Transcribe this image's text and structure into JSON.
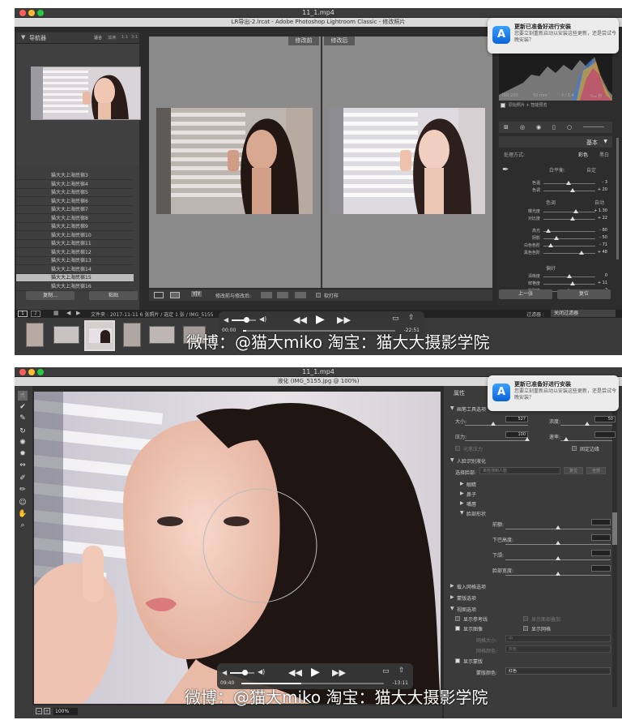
{
  "shot1": {
    "mac_title": "11_1.mp4",
    "window_title": "LR导出-2.lrcat - Adobe Photoshop Lightroom Classic - 修改照片",
    "notification": {
      "title": "更新已准备好进行安装",
      "body": "您要立刻重新启动以安装这些更新，还是尝试今晚安装？"
    },
    "navigator": {
      "title": "导航器",
      "options": [
        "适合",
        "填满",
        "1:1",
        "3:1"
      ]
    },
    "files": [
      "猫大大上海民宿3",
      "猫大大上海民宿4",
      "猫大大上海民宿5",
      "猫大大上海民宿6",
      "猫大大上海民宿7",
      "猫大大上海民宿8",
      "猫大大上海民宿9",
      "猫大大上海民宿10",
      "猫大大上海民宿11",
      "猫大大上海民宿12",
      "猫大大上海民宿13",
      "猫大大上海民宿14",
      "猫大大上海民宿15",
      "猫大大上海民宿16"
    ],
    "selected_file_index": 12,
    "copy_button": "复制...",
    "paste_button": "粘贴",
    "before_label": "修改前",
    "after_label": "修改后",
    "toolbar": {
      "compare_label": "修改前与修改后:",
      "proof_label": "软打样",
      "yy_label": "Y|Y"
    },
    "histogram_info": {
      "iso": "ISO 200",
      "focal": "50 mm",
      "aperture": "f / 1.4",
      "shutter": "¹⁄₂₅₀ 秒",
      "original": "原始照片 + 智能预览"
    },
    "basic": {
      "title": "基本",
      "treatment_label": "处理方式:",
      "color": "彩色",
      "bw": "黑白",
      "wb_label": "白平衡:",
      "wb_value": "自定",
      "tone_label": "色调",
      "tone_auto": "自动",
      "presence_label": "偏好",
      "sliders": [
        {
          "label": "色温",
          "value": "- 3",
          "pos": 0.48
        },
        {
          "label": "色调",
          "value": "+ 20",
          "pos": 0.56
        },
        {
          "label": "曝光度",
          "value": "+ 1.30",
          "pos": 0.62
        },
        {
          "label": "对比度",
          "value": "+ 22",
          "pos": 0.56
        },
        {
          "label": "高光",
          "value": "- 80",
          "pos": 0.1
        },
        {
          "label": "阴影",
          "value": "- 50",
          "pos": 0.25
        },
        {
          "label": "白色色阶",
          "value": "- 71",
          "pos": 0.14
        },
        {
          "label": "黑色色阶",
          "value": "+ 48",
          "pos": 0.74
        },
        {
          "label": "清晰度",
          "value": "0",
          "pos": 0.5
        },
        {
          "label": "鲜艳度",
          "value": "+ 11",
          "pos": 0.56
        },
        {
          "label": "饱和度",
          "value": "- 2",
          "pos": 0.49
        }
      ]
    },
    "prev_button": "上一张",
    "reset_button": "复位",
    "filmstrip_info": "文件夹 : 2017-11-11   6 张照片 / 选定 1 张 / IMG_5155",
    "filter_label": "过滤器 :",
    "filter_value": "关闭过滤器",
    "page_tabs": [
      "1",
      "2"
    ],
    "player": {
      "elapsed": "00:00",
      "remaining": "-22:51",
      "progress": 0.02,
      "volume": 0.6
    },
    "subtitle": "微博：@猫大miko    淘宝：猫大大摄影学院"
  },
  "shot2": {
    "mac_title": "11_1.mp4",
    "window_title": "液化 (IMG_5155.jpg @ 100%)",
    "notification": {
      "title": "更新已准备好进行安装",
      "body": "您要立刻重新启动以安装这些更新，还是尝试今晚安装？"
    },
    "properties_title": "属性",
    "brush": {
      "section": "画笔工具选项",
      "size_label": "大小:",
      "size_value": "527",
      "density_label": "浓度:",
      "density_value": "50",
      "pressure_label": "压力:",
      "pressure_value": "100",
      "rate_label": "速率:",
      "stylus_label": "光笔压力",
      "pin_edges_label": "固定边缘"
    },
    "face_aware": {
      "section": "人脸识别液化",
      "select_face_label": "选择脸部:",
      "select_face_value": "未检测到人脸",
      "reset_btn": "复位",
      "all_btn": "全部",
      "items": [
        "眼睛",
        "鼻子",
        "嘴唇",
        "脸部形状"
      ],
      "face_sliders": [
        {
          "label": "前额:",
          "pos": 0.5
        },
        {
          "label": "下巴高度:",
          "pos": 0.5
        },
        {
          "label": "下颌:",
          "pos": 0.5
        },
        {
          "label": "脸部宽度:",
          "pos": 0.5
        }
      ]
    },
    "load_mesh": "载入网格选项",
    "mask_options": "蒙版选项",
    "view_options": "视图选项",
    "show_guides": "显示参考线",
    "show_face_overlay": "显示面部叠加",
    "show_image": "显示图像",
    "show_mesh": "显示网格",
    "mesh_size_label": "网格大小:",
    "mesh_size_value": "中",
    "mesh_color_label": "网格颜色:",
    "mesh_color_value": "灰色",
    "show_mask": "显示蒙版",
    "mask_color_label": "蒙版颜色:",
    "mask_color_value": "红色",
    "zoom": "100%",
    "player": {
      "elapsed": "09:40",
      "remaining": "-13:11",
      "progress": 0.42,
      "volume": 0.6
    },
    "subtitle": "微博：@猫大miko    淘宝：猫大大摄影学院"
  }
}
